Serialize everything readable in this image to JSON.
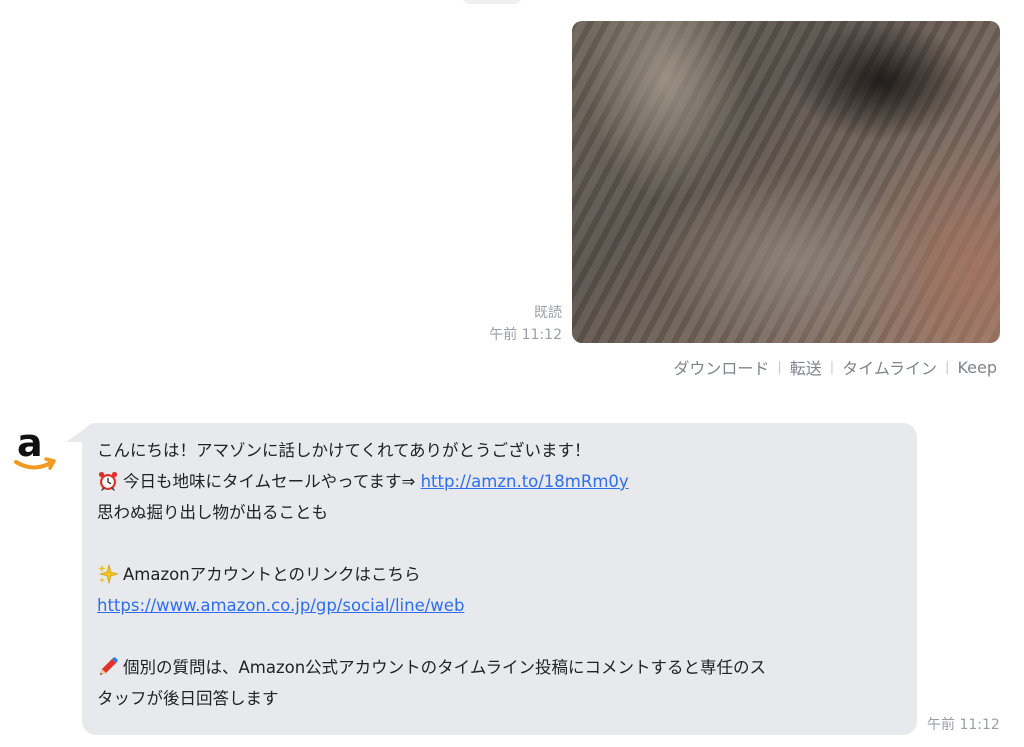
{
  "outgoing_image_message": {
    "read_label": "既読",
    "time": "午前 11:12",
    "actions": [
      "ダウンロード",
      "転送",
      "タイムライン",
      "Keep"
    ]
  },
  "incoming_message": {
    "sender_icon": "amazon-logo-icon",
    "lines": {
      "greeting": "こんにちは！アマゾンに話しかけてくれてありがとうございます！",
      "sale_text": "今日も地味にタイムセールやってます⇒ ",
      "sale_link": "http://amzn.to/18mRm0y",
      "finds": "思わぬ掘り出し物が出ることも",
      "account_text": "Amazonアカウントとのリンクはこちら",
      "account_link": "https://www.amazon.co.jp/gp/social/line/web",
      "question_line1": "個別の質問は、Amazon公式アカウントのタイムライン投稿にコメントすると専任のス",
      "question_line2": "タッフが後日回答します"
    },
    "emoji_icons": [
      "alarm-clock-icon",
      "sparkles-icon",
      "pencil-icon"
    ],
    "time": "午前 11:12"
  },
  "colors": {
    "bubble_bg": "#e7e9ec",
    "link": "#2d6ef0",
    "meta_text": "#9ba0a8",
    "amazon_orange": "#f29a1f"
  }
}
